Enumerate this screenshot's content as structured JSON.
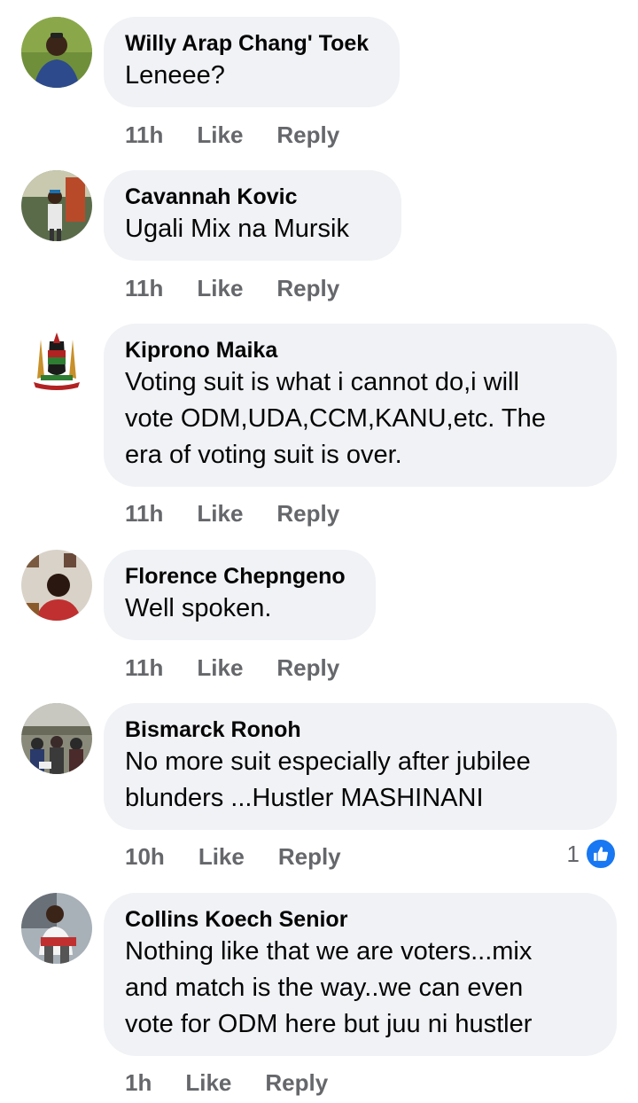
{
  "comments": [
    {
      "author": "Willy Arap Chang' Toek",
      "text": "Leneee?",
      "time": "11h",
      "like_label": "Like",
      "reply_label": "Reply"
    },
    {
      "author": "Cavannah Kovic",
      "text": "Ugali Mix na Mursik",
      "time": "11h",
      "like_label": "Like",
      "reply_label": "Reply"
    },
    {
      "author": "Kiprono Maika",
      "text": "Voting suit is what i cannot do,i will\nvote ODM,UDA,CCM,KANU,etc. The\nera of voting suit is over.",
      "time": "11h",
      "like_label": "Like",
      "reply_label": "Reply"
    },
    {
      "author": "Florence Chepngeno",
      "text": "Well spoken.",
      "time": "11h",
      "like_label": "Like",
      "reply_label": "Reply"
    },
    {
      "author": "Bismarck Ronoh",
      "text": "No more suit especially after jubilee\nblunders ...Hustler MASHINANI",
      "time": "10h",
      "like_label": "Like",
      "reply_label": "Reply",
      "reaction_count": "1",
      "reaction_icon": "thumbs-up-icon"
    },
    {
      "author": "Collins Koech Senior",
      "text": "Nothing like that we are voters...mix\nand match is the way..we can even\nvote for ODM here but juu ni hustler",
      "time": "1h",
      "like_label": "Like",
      "reply_label": "Reply"
    }
  ],
  "colors": {
    "bubble": "#f0f2f5",
    "name": "#050505",
    "meta": "#65676b",
    "like_badge": "#1877f2"
  }
}
